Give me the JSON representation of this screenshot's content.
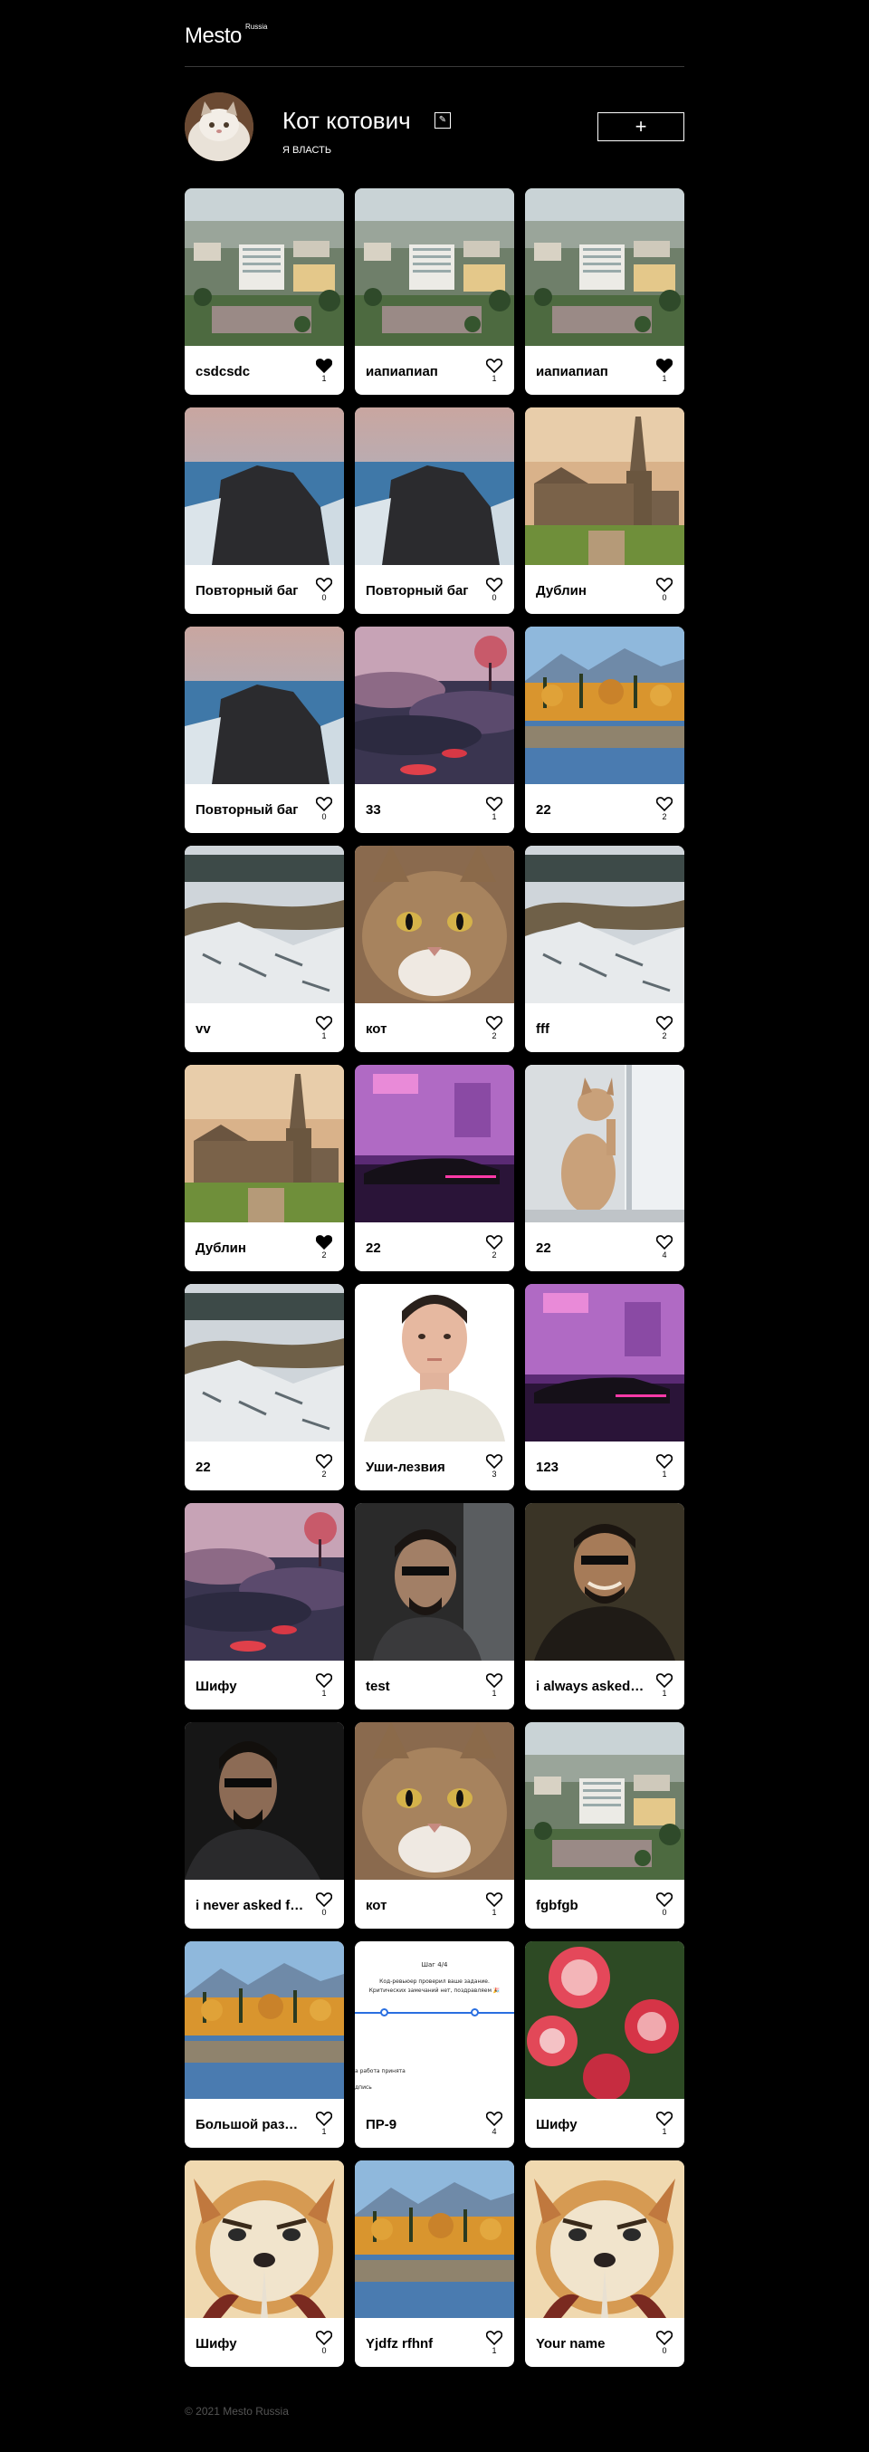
{
  "header": {
    "logo": "Mesto",
    "logo_sup": "Russia"
  },
  "profile": {
    "name": "Кот котович",
    "about": "Я ВЛАСТЬ",
    "add_label": "+"
  },
  "cards": [
    {
      "title": "csdcsdc",
      "likes": "1",
      "liked": true,
      "image": "city"
    },
    {
      "title": "иапиапиап",
      "likes": "1",
      "liked": false,
      "image": "city"
    },
    {
      "title": "иапиапиап",
      "likes": "1",
      "liked": true,
      "image": "city"
    },
    {
      "title": "Повторный баг",
      "likes": "0",
      "liked": false,
      "image": "cliff"
    },
    {
      "title": "Повторный баг",
      "likes": "0",
      "liked": false,
      "image": "cliff"
    },
    {
      "title": "Дублин",
      "likes": "0",
      "liked": false,
      "image": "cathedral"
    },
    {
      "title": "Повторный баг",
      "likes": "0",
      "liked": false,
      "image": "cliff"
    },
    {
      "title": "33",
      "likes": "1",
      "liked": false,
      "image": "fantasy"
    },
    {
      "title": "22",
      "likes": "2",
      "liked": false,
      "image": "lake"
    },
    {
      "title": "vv",
      "likes": "1",
      "liked": false,
      "image": "snowriver"
    },
    {
      "title": "кот",
      "likes": "2",
      "liked": false,
      "image": "cat"
    },
    {
      "title": "fff",
      "likes": "2",
      "liked": false,
      "image": "snowriver"
    },
    {
      "title": "Дублин",
      "likes": "2",
      "liked": true,
      "image": "cathedral"
    },
    {
      "title": "22",
      "likes": "2",
      "liked": false,
      "image": "cyber"
    },
    {
      "title": "22",
      "likes": "4",
      "liked": false,
      "image": "kitten"
    },
    {
      "title": "22",
      "likes": "2",
      "liked": false,
      "image": "snowriver"
    },
    {
      "title": "Уши-лезвия",
      "likes": "3",
      "liked": false,
      "image": "boy"
    },
    {
      "title": "123",
      "likes": "1",
      "liked": false,
      "image": "cyber"
    },
    {
      "title": "Шифу",
      "likes": "1",
      "liked": false,
      "image": "fantasy"
    },
    {
      "title": "test",
      "likes": "1",
      "liked": false,
      "image": "adam"
    },
    {
      "title": "i always asked for this",
      "likes": "1",
      "liked": false,
      "image": "adamsmile"
    },
    {
      "title": "i never asked for this",
      "likes": "0",
      "liked": false,
      "image": "adam2"
    },
    {
      "title": "кот",
      "likes": "1",
      "liked": false,
      "image": "cat"
    },
    {
      "title": "fgbfgb",
      "likes": "0",
      "liked": false,
      "image": "city"
    },
    {
      "title": "Большой размер",
      "likes": "1",
      "liked": false,
      "image": "lake"
    },
    {
      "title": "ПР-9",
      "likes": "4",
      "liked": false,
      "image": "shot"
    },
    {
      "title": "Шифу",
      "likes": "1",
      "liked": false,
      "image": "roses"
    },
    {
      "title": "Шифу",
      "likes": "0",
      "liked": false,
      "image": "shifu"
    },
    {
      "title": "Yjdfz rfhnf",
      "likes": "1",
      "liked": false,
      "image": "lake"
    },
    {
      "title": "Your name",
      "likes": "0",
      "liked": false,
      "image": "shifu"
    }
  ],
  "screenshot_card": {
    "step": "Шаг 4/4",
    "line1": "Код-ревьюер проверил ваше задание.",
    "line2": "Критических замечаний нет, поздравляем 🎉",
    "line3": "а работа принята",
    "line4": "дпись"
  },
  "footer": {
    "copyright": "© 2021 Mesto Russia"
  },
  "colors": {
    "background": "#000000",
    "card": "#ffffff",
    "muted": "#545454"
  }
}
